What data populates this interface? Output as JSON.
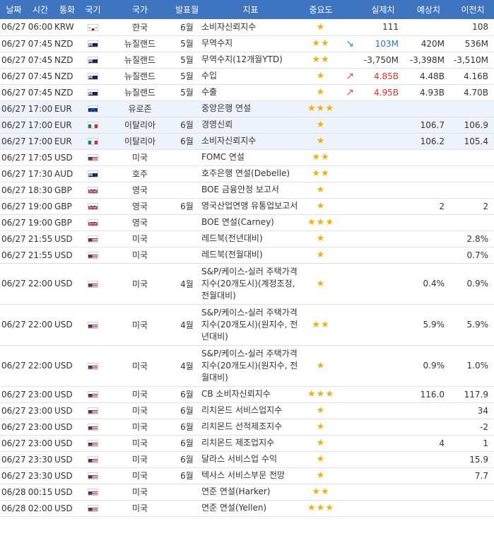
{
  "headers": [
    "날짜",
    "시간",
    "통화",
    "국기",
    "국가",
    "발표월",
    "지표",
    "중요도",
    "",
    "실제치",
    "예상치",
    "이전치"
  ],
  "rows": [
    {
      "date": "06/27",
      "time": "06:00",
      "currency": "KRW",
      "flag": "kr-flag-icon",
      "country": "한국",
      "month": "6월",
      "indicator": "소비자신뢰지수",
      "importance": "★",
      "trend": "",
      "actual": "111",
      "actual_color": "",
      "forecast": "",
      "previous": "108",
      "tall": false,
      "hl": false
    },
    {
      "date": "06/27",
      "time": "07:45",
      "currency": "NZD",
      "flag": "nz-flag-icon",
      "country": "뉴질랜드",
      "month": "5월",
      "indicator": "무역수지",
      "importance": "★★",
      "trend": "down",
      "actual": "103M",
      "actual_color": "blue",
      "forecast": "420M",
      "previous": "536M",
      "tall": false,
      "hl": false
    },
    {
      "date": "06/27",
      "time": "07:45",
      "currency": "NZD",
      "flag": "nz-flag-icon",
      "country": "뉴질랜드",
      "month": "5월",
      "indicator": "무역수지(12개월YTD)",
      "importance": "★★",
      "trend": "",
      "actual": "-3,750M",
      "actual_color": "",
      "forecast": "-3,398M",
      "previous": "-3,510M",
      "tall": false,
      "hl": false
    },
    {
      "date": "06/27",
      "time": "07:45",
      "currency": "NZD",
      "flag": "nz-flag-icon",
      "country": "뉴질랜드",
      "month": "5월",
      "indicator": "수입",
      "importance": "★",
      "trend": "up",
      "actual": "4.85B",
      "actual_color": "red",
      "forecast": "4.48B",
      "previous": "4.16B",
      "tall": false,
      "hl": false
    },
    {
      "date": "06/27",
      "time": "07:45",
      "currency": "NZD",
      "flag": "nz-flag-icon",
      "country": "뉴질랜드",
      "month": "5월",
      "indicator": "수출",
      "importance": "★",
      "trend": "up",
      "actual": "4.95B",
      "actual_color": "red",
      "forecast": "4.93B",
      "previous": "4.70B",
      "tall": false,
      "hl": false
    },
    {
      "date": "06/27",
      "time": "17:00",
      "currency": "EUR",
      "flag": "eu-flag-icon",
      "country": "유로존",
      "month": "",
      "indicator": "중앙은행 연설",
      "importance": "★★★",
      "trend": "",
      "actual": "",
      "actual_color": "",
      "forecast": "",
      "previous": "",
      "tall": false,
      "hl": true
    },
    {
      "date": "06/27",
      "time": "17:00",
      "currency": "EUR",
      "flag": "it-flag-icon",
      "country": "이탈리아",
      "month": "6월",
      "indicator": "경영신뢰",
      "importance": "★",
      "trend": "",
      "actual": "",
      "actual_color": "",
      "forecast": "106.7",
      "previous": "106.9",
      "tall": false,
      "hl": true
    },
    {
      "date": "06/27",
      "time": "17:00",
      "currency": "EUR",
      "flag": "it-flag-icon",
      "country": "이탈리아",
      "month": "6월",
      "indicator": "소비자신뢰지수",
      "importance": "★",
      "trend": "",
      "actual": "",
      "actual_color": "",
      "forecast": "106.2",
      "previous": "105.4",
      "tall": false,
      "hl": true
    },
    {
      "date": "06/27",
      "time": "17:05",
      "currency": "USD",
      "flag": "us-flag-icon",
      "country": "미국",
      "month": "",
      "indicator": "FOMC 연설",
      "importance": "★★",
      "trend": "",
      "actual": "",
      "actual_color": "",
      "forecast": "",
      "previous": "",
      "tall": false,
      "hl": false
    },
    {
      "date": "06/27",
      "time": "17:30",
      "currency": "AUD",
      "flag": "au-flag-icon",
      "country": "호주",
      "month": "",
      "indicator": "호주은행 연설(Debelle)",
      "importance": "★★",
      "trend": "",
      "actual": "",
      "actual_color": "",
      "forecast": "",
      "previous": "",
      "tall": false,
      "hl": false
    },
    {
      "date": "06/27",
      "time": "18:30",
      "currency": "GBP",
      "flag": "gb-flag-icon",
      "country": "영국",
      "month": "",
      "indicator": "BOE 금융안정 보고서",
      "importance": "★",
      "trend": "",
      "actual": "",
      "actual_color": "",
      "forecast": "",
      "previous": "",
      "tall": false,
      "hl": false
    },
    {
      "date": "06/27",
      "time": "19:00",
      "currency": "GBP",
      "flag": "gb-flag-icon",
      "country": "영국",
      "month": "6월",
      "indicator": "영국산업연맹 유통업보고서",
      "importance": "★",
      "trend": "",
      "actual": "",
      "actual_color": "",
      "forecast": "2",
      "previous": "2",
      "tall": false,
      "hl": false
    },
    {
      "date": "06/27",
      "time": "19:00",
      "currency": "GBP",
      "flag": "gb-flag-icon",
      "country": "영국",
      "month": "",
      "indicator": "BOE 연설(Carney)",
      "importance": "★★★",
      "trend": "",
      "actual": "",
      "actual_color": "",
      "forecast": "",
      "previous": "",
      "tall": false,
      "hl": false
    },
    {
      "date": "06/27",
      "time": "21:55",
      "currency": "USD",
      "flag": "us-flag-icon",
      "country": "미국",
      "month": "",
      "indicator": "레드북(전년대비)",
      "importance": "★",
      "trend": "",
      "actual": "",
      "actual_color": "",
      "forecast": "",
      "previous": "2.8%",
      "tall": false,
      "hl": false
    },
    {
      "date": "06/27",
      "time": "21:55",
      "currency": "USD",
      "flag": "us-flag-icon",
      "country": "미국",
      "month": "",
      "indicator": "레드북(전월대비)",
      "importance": "★",
      "trend": "",
      "actual": "",
      "actual_color": "",
      "forecast": "",
      "previous": "0.7%",
      "tall": false,
      "hl": false
    },
    {
      "date": "06/27",
      "time": "22:00",
      "currency": "USD",
      "flag": "us-flag-icon",
      "country": "미국",
      "month": "4월",
      "indicator": "S&P/케이스-실러 주택가격지수(20개도시)(계정조정, 전월대비)",
      "importance": "★",
      "trend": "",
      "actual": "",
      "actual_color": "",
      "forecast": "0.4%",
      "previous": "0.9%",
      "tall": true,
      "hl": false
    },
    {
      "date": "06/27",
      "time": "22:00",
      "currency": "USD",
      "flag": "us-flag-icon",
      "country": "미국",
      "month": "4월",
      "indicator": "S&P/케이스-실러 주택가격지수(20개도시)(원지수, 전년대비)",
      "importance": "★★",
      "trend": "",
      "actual": "",
      "actual_color": "",
      "forecast": "5.9%",
      "previous": "5.9%",
      "tall": true,
      "hl": false
    },
    {
      "date": "06/27",
      "time": "22:00",
      "currency": "USD",
      "flag": "us-flag-icon",
      "country": "미국",
      "month": "4월",
      "indicator": "S&P/케이스-실러 주택가격지수(20개도시)(원지수, 전월대비)",
      "importance": "★",
      "trend": "",
      "actual": "",
      "actual_color": "",
      "forecast": "0.9%",
      "previous": "1.0%",
      "tall": true,
      "hl": false
    },
    {
      "date": "06/27",
      "time": "23:00",
      "currency": "USD",
      "flag": "us-flag-icon",
      "country": "미국",
      "month": "6월",
      "indicator": "CB 소비자신뢰지수",
      "importance": "★★★",
      "trend": "",
      "actual": "",
      "actual_color": "",
      "forecast": "116.0",
      "previous": "117.9",
      "tall": false,
      "hl": false
    },
    {
      "date": "06/27",
      "time": "23:00",
      "currency": "USD",
      "flag": "us-flag-icon",
      "country": "미국",
      "month": "6월",
      "indicator": "리치몬드 서비스업지수",
      "importance": "★",
      "trend": "",
      "actual": "",
      "actual_color": "",
      "forecast": "",
      "previous": "34",
      "tall": false,
      "hl": false
    },
    {
      "date": "06/27",
      "time": "23:00",
      "currency": "USD",
      "flag": "us-flag-icon",
      "country": "미국",
      "month": "6월",
      "indicator": "리치몬드 선적제조지수",
      "importance": "★",
      "trend": "",
      "actual": "",
      "actual_color": "",
      "forecast": "",
      "previous": "-2",
      "tall": false,
      "hl": false
    },
    {
      "date": "06/27",
      "time": "23:00",
      "currency": "USD",
      "flag": "us-flag-icon",
      "country": "미국",
      "month": "6월",
      "indicator": "리치몬드 제조업지수",
      "importance": "★",
      "trend": "",
      "actual": "",
      "actual_color": "",
      "forecast": "4",
      "previous": "1",
      "tall": false,
      "hl": false
    },
    {
      "date": "06/27",
      "time": "23:30",
      "currency": "USD",
      "flag": "us-flag-icon",
      "country": "미국",
      "month": "6월",
      "indicator": "달라스 서비스업 수익",
      "importance": "★",
      "trend": "",
      "actual": "",
      "actual_color": "",
      "forecast": "",
      "previous": "15.9",
      "tall": false,
      "hl": false
    },
    {
      "date": "06/27",
      "time": "23:30",
      "currency": "USD",
      "flag": "us-flag-icon",
      "country": "미국",
      "month": "6월",
      "indicator": "텍사스 서비스부문 전망",
      "importance": "★",
      "trend": "",
      "actual": "",
      "actual_color": "",
      "forecast": "",
      "previous": "7.7",
      "tall": false,
      "hl": false
    },
    {
      "date": "06/28",
      "time": "00:15",
      "currency": "USD",
      "flag": "us-flag-icon",
      "country": "미국",
      "month": "",
      "indicator": "연준 연설(Harker)",
      "importance": "★★",
      "trend": "",
      "actual": "",
      "actual_color": "",
      "forecast": "",
      "previous": "",
      "tall": false,
      "hl": false
    },
    {
      "date": "06/28",
      "time": "02:00",
      "currency": "USD",
      "flag": "us-flag-icon",
      "country": "미국",
      "month": "",
      "indicator": "연준 연설(Yellen)",
      "importance": "★★★",
      "trend": "",
      "actual": "",
      "actual_color": "",
      "forecast": "",
      "previous": "",
      "tall": false,
      "hl": false
    }
  ]
}
